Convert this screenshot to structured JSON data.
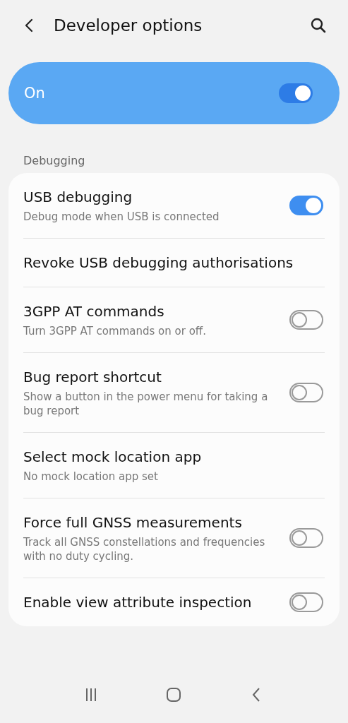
{
  "header": {
    "title": "Developer options"
  },
  "master": {
    "label": "On",
    "on": true
  },
  "section": {
    "title": "Debugging"
  },
  "items": [
    {
      "kind": "toggle",
      "title": "USB debugging",
      "subtitle": "Debug mode when USB is connected",
      "on": true
    },
    {
      "kind": "plain",
      "title": "Revoke USB debugging authorisations"
    },
    {
      "kind": "toggle",
      "title": "3GPP AT commands",
      "subtitle": "Turn 3GPP AT commands on or off.",
      "on": false
    },
    {
      "kind": "toggle",
      "title": "Bug report shortcut",
      "subtitle": "Show a button in the power menu for taking a bug report",
      "on": false
    },
    {
      "kind": "plain",
      "title": "Select mock location app",
      "subtitle": "No mock location app set"
    },
    {
      "kind": "toggle",
      "title": "Force full GNSS measurements",
      "subtitle": "Track all GNSS constellations and frequencies with no duty cycling.",
      "on": false
    },
    {
      "kind": "toggle",
      "title": "Enable view attribute inspection",
      "on": false
    }
  ]
}
